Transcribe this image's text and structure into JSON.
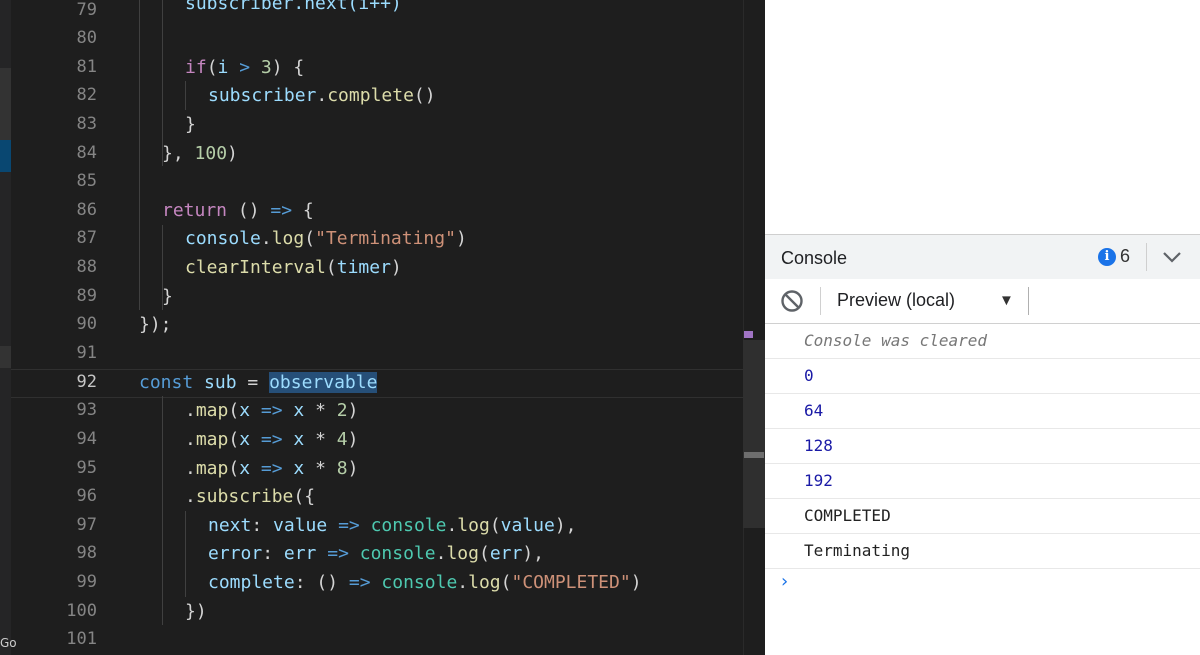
{
  "editor": {
    "first_line_partial": "subscriber.next(i++)",
    "line_numbers": [
      "79",
      "80",
      "81",
      "82",
      "83",
      "84",
      "85",
      "86",
      "87",
      "88",
      "89",
      "90",
      "91",
      "92",
      "93",
      "94",
      "95",
      "96",
      "97",
      "98",
      "99",
      "100",
      "101"
    ],
    "active_line_number": "92",
    "status_fragment": "Go",
    "code": {
      "l81": {
        "kw": "if",
        "open": "(",
        "var": "i",
        "op": ">",
        "num": "3",
        "close": ") {"
      },
      "l82": {
        "obj": "subscriber",
        "dot": ".",
        "fn": "complete",
        "paren": "()"
      },
      "l83": "}",
      "l84": {
        "close": "}, ",
        "num": "100",
        "paren": ")"
      },
      "l86": {
        "kw": "return",
        "parens": " () ",
        "arrow": "=>",
        "brace": " {"
      },
      "l87": {
        "obj": "console",
        "dot": ".",
        "fn": "log",
        "open": "(",
        "str": "\"Terminating\"",
        "close": ")"
      },
      "l88": {
        "fn": "clearInterval",
        "open": "(",
        "arg": "timer",
        "close": ")"
      },
      "l89": "}",
      "l90": "});",
      "l92": {
        "kw": "const",
        "var": "sub",
        "eq": " = ",
        "obj": "observable"
      },
      "l93": {
        "dot": ".",
        "fn": "map",
        "open": "(",
        "param": "x",
        "arrow": " => ",
        "expr": "x",
        "op": " * ",
        "num": "2",
        "close": ")"
      },
      "l94": {
        "dot": ".",
        "fn": "map",
        "open": "(",
        "param": "x",
        "arrow": " => ",
        "expr": "x",
        "op": " * ",
        "num": "4",
        "close": ")"
      },
      "l95": {
        "dot": ".",
        "fn": "map",
        "open": "(",
        "param": "x",
        "arrow": " => ",
        "expr": "x",
        "op": " * ",
        "num": "8",
        "close": ")"
      },
      "l96": {
        "dot": ".",
        "fn": "subscribe",
        "open": "({"
      },
      "l97": {
        "key": "next",
        "colon": ": ",
        "param": "value",
        "arrow": " => ",
        "obj": "console",
        "dot": ".",
        "fn": "log",
        "open": "(",
        "arg": "value",
        "close": "),"
      },
      "l98": {
        "key": "error",
        "colon": ": ",
        "param": "err",
        "arrow": " => ",
        "obj": "console",
        "dot": ".",
        "fn": "log",
        "open": "(",
        "arg": "err",
        "close": "),"
      },
      "l99": {
        "key": "complete",
        "colon": ": ",
        "parens": "() ",
        "arrow": "=> ",
        "obj": "console",
        "dot": ".",
        "fn": "log",
        "open": "(",
        "str": "\"COMPLETED\"",
        "close": ")"
      },
      "l100": "})"
    }
  },
  "devtools": {
    "tab_label": "Console",
    "issue_count": "6",
    "info_icon_glyph": "i",
    "context_label": "Preview (local)",
    "context_arrow": "▼",
    "prompt_glyph": "›",
    "messages": [
      {
        "text": "Console was cleared",
        "kind": "cleared"
      },
      {
        "text": "0",
        "kind": "num"
      },
      {
        "text": "64",
        "kind": "num"
      },
      {
        "text": "128",
        "kind": "num"
      },
      {
        "text": "192",
        "kind": "num"
      },
      {
        "text": "COMPLETED",
        "kind": "str"
      },
      {
        "text": "Terminating",
        "kind": "str"
      }
    ]
  },
  "colors": {
    "keyword": "#c586c0",
    "variable": "#9cdcfe",
    "function": "#dcdcaa",
    "number": "#b5cea8",
    "string": "#ce9178",
    "console_number": "#1a1aa6",
    "info_blue": "#1a73e8"
  }
}
